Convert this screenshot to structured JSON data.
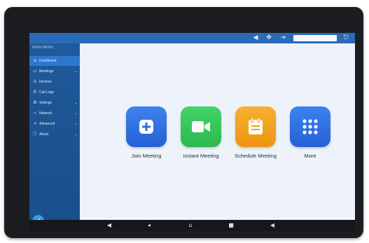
{
  "topbar": {
    "icons": [
      "volume-icon",
      "move-icon",
      "sign-in-icon",
      "exit-icon"
    ]
  },
  "sidebar": {
    "title": "MAIN MENU",
    "items": [
      {
        "label": "Dashboard",
        "icon": "home-icon",
        "active": true,
        "chevron": false
      },
      {
        "label": "Meetings",
        "icon": "calendar-icon",
        "active": false,
        "chevron": true
      },
      {
        "label": "Devices",
        "icon": "user-icon",
        "active": false,
        "chevron": false
      },
      {
        "label": "Call Logs",
        "icon": "phone-icon",
        "active": false,
        "chevron": false
      },
      {
        "label": "Settings",
        "icon": "gear-icon",
        "active": false,
        "chevron": true
      },
      {
        "label": "Network",
        "icon": "filter-icon",
        "active": false,
        "chevron": true
      },
      {
        "label": "Advanced",
        "icon": "share-icon",
        "active": false,
        "chevron": true
      },
      {
        "label": "About",
        "icon": "info-icon",
        "active": false,
        "chevron": true
      }
    ]
  },
  "apps": [
    {
      "label": "Join Meeting",
      "icon": "plus-icon",
      "color": "#2f6fe0"
    },
    {
      "label": "Instant Meeting",
      "icon": "video-camera-icon",
      "color": "#34c759"
    },
    {
      "label": "Schedule Meeting",
      "icon": "calendar-clipboard-icon",
      "color": "#f4a21b"
    },
    {
      "label": "More",
      "icon": "grid-icon",
      "color": "#3071e6"
    }
  ],
  "navbar": {
    "icons": [
      "volume-down-icon",
      "back-icon",
      "home-icon",
      "recent-apps-icon",
      "volume-up-icon"
    ]
  },
  "colors": {
    "sidebar": "#1f5a9b",
    "topbar": "#2a6bb7",
    "active_item": "#2d78cf",
    "fab": "#2fa2ea",
    "background": "#eef3fb"
  }
}
